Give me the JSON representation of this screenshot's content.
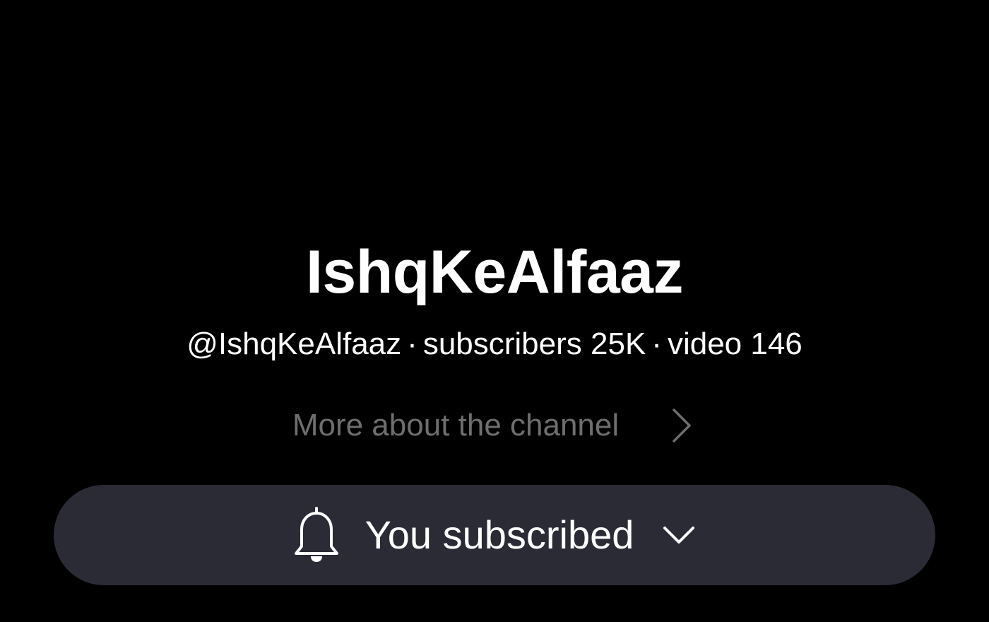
{
  "channel": {
    "name": "IshqKeAlfaaz",
    "handle": "@IshqKeAlfaaz",
    "subscribers": "subscribers 25K",
    "videos": "video 146",
    "separator": "·"
  },
  "more_link": {
    "label": "More about the channel",
    "icon": "chevron-right-icon"
  },
  "subscribe_button": {
    "label": "You subscribed",
    "icon_left": "bell-icon",
    "icon_right": "chevron-down-icon"
  },
  "colors": {
    "background": "#000000",
    "text_primary": "#ffffff",
    "text_muted": "#6e6e6e",
    "button_bg": "#2b2b36"
  }
}
